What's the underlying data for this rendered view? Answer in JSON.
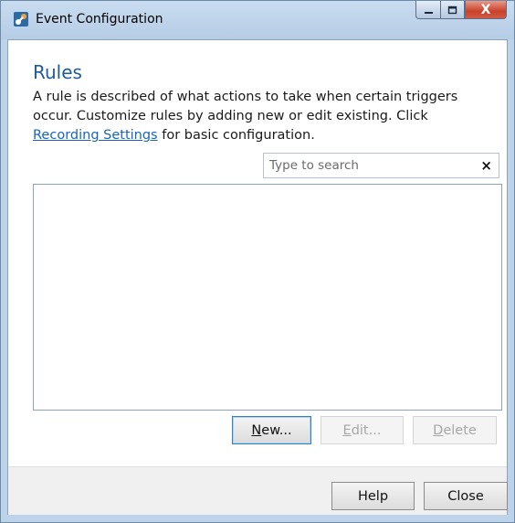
{
  "window": {
    "title": "Event Configuration",
    "close_glyph": "X"
  },
  "rules": {
    "heading": "Rules",
    "description_before_link": "A rule is described of what actions to take when certain triggers occur. Customize rules by adding new or edit existing. Click ",
    "link_text": "Recording Settings",
    "description_after_link": " for basic configuration."
  },
  "search": {
    "placeholder": "Type to search",
    "value": "",
    "clear_glyph": "×"
  },
  "list": {
    "items": []
  },
  "buttons": {
    "new": {
      "mnemonic": "N",
      "rest": "ew...",
      "enabled": true
    },
    "edit": {
      "mnemonic": "E",
      "rest": "dit...",
      "enabled": false
    },
    "delete": {
      "mnemonic": "D",
      "rest": "elete",
      "enabled": false
    }
  },
  "footer": {
    "help_label": "Help",
    "close_label": "Close"
  },
  "colors": {
    "heading": "#1e5b9b",
    "link": "#1a64b8",
    "titlebar": "#bcd3ea",
    "close_button": "#c8412b"
  },
  "icons": {
    "app": "event-configuration-app-icon",
    "minimize": "minimize-icon",
    "maximize": "maximize-icon",
    "close": "close-icon",
    "search_clear": "clear-icon"
  }
}
